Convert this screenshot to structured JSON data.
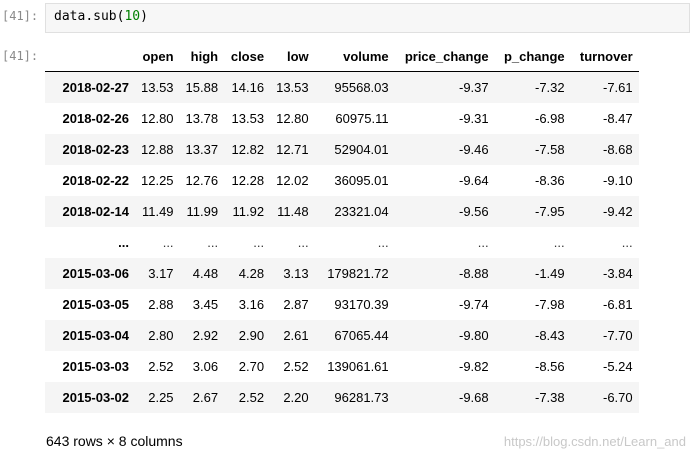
{
  "input_prompt": "[41]:",
  "output_prompt": "[41]:",
  "code": {
    "object": "data",
    "method": "sub",
    "arg": "10"
  },
  "columns": [
    "open",
    "high",
    "close",
    "low",
    "volume",
    "price_change",
    "p_change",
    "turnover"
  ],
  "rows": [
    {
      "index": "2018-02-27",
      "cells": [
        "13.53",
        "15.88",
        "14.16",
        "13.53",
        "95568.03",
        "-9.37",
        "-7.32",
        "-7.61"
      ]
    },
    {
      "index": "2018-02-26",
      "cells": [
        "12.80",
        "13.78",
        "13.53",
        "12.80",
        "60975.11",
        "-9.31",
        "-6.98",
        "-8.47"
      ]
    },
    {
      "index": "2018-02-23",
      "cells": [
        "12.88",
        "13.37",
        "12.82",
        "12.71",
        "52904.01",
        "-9.46",
        "-7.58",
        "-8.68"
      ]
    },
    {
      "index": "2018-02-22",
      "cells": [
        "12.25",
        "12.76",
        "12.28",
        "12.02",
        "36095.01",
        "-9.64",
        "-8.36",
        "-9.10"
      ]
    },
    {
      "index": "2018-02-14",
      "cells": [
        "11.49",
        "11.99",
        "11.92",
        "11.48",
        "23321.04",
        "-9.56",
        "-7.95",
        "-9.42"
      ]
    },
    {
      "index": "...",
      "cells": [
        "...",
        "...",
        "...",
        "...",
        "...",
        "...",
        "...",
        "..."
      ]
    },
    {
      "index": "2015-03-06",
      "cells": [
        "3.17",
        "4.48",
        "4.28",
        "3.13",
        "179821.72",
        "-8.88",
        "-1.49",
        "-3.84"
      ]
    },
    {
      "index": "2015-03-05",
      "cells": [
        "2.88",
        "3.45",
        "3.16",
        "2.87",
        "93170.39",
        "-9.74",
        "-7.98",
        "-6.81"
      ]
    },
    {
      "index": "2015-03-04",
      "cells": [
        "2.80",
        "2.92",
        "2.90",
        "2.61",
        "67065.44",
        "-9.80",
        "-8.43",
        "-7.70"
      ]
    },
    {
      "index": "2015-03-03",
      "cells": [
        "2.52",
        "3.06",
        "2.70",
        "2.52",
        "139061.61",
        "-9.82",
        "-8.56",
        "-5.24"
      ]
    },
    {
      "index": "2015-03-02",
      "cells": [
        "2.25",
        "2.67",
        "2.52",
        "2.20",
        "96281.73",
        "-9.68",
        "-7.38",
        "-6.70"
      ]
    }
  ],
  "footer": "643 rows × 8 columns",
  "watermark": "https://blog.csdn.net/Learn_and"
}
